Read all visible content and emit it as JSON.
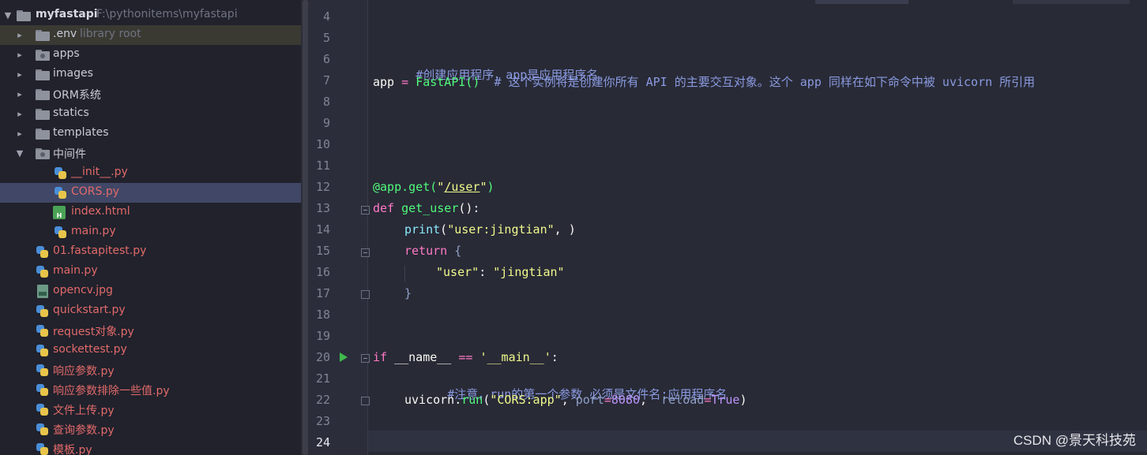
{
  "project": {
    "name": "myfastapi",
    "path": "F:\\pythonitems\\myfastapi"
  },
  "tree": [
    {
      "label": "myfastapi",
      "extra": "F:\\pythonitems\\myfastapi"
    },
    {
      "label": ".env",
      "extra": "library root"
    },
    {
      "label": "apps"
    },
    {
      "label": "images"
    },
    {
      "label": "ORM系统"
    },
    {
      "label": "statics"
    },
    {
      "label": "templates"
    },
    {
      "label": "中间件"
    },
    {
      "label": "__init__.py"
    },
    {
      "label": "CORS.py"
    },
    {
      "label": "index.html"
    },
    {
      "label": "main.py"
    },
    {
      "label": "01.fastapitest.py"
    },
    {
      "label": "main.py"
    },
    {
      "label": "opencv.jpg"
    },
    {
      "label": "quickstart.py"
    },
    {
      "label": "request对象.py"
    },
    {
      "label": "sockettest.py"
    },
    {
      "label": "响应参数.py"
    },
    {
      "label": "响应参数排除一些值.py"
    },
    {
      "label": "文件上传.py"
    },
    {
      "label": "查询参数.py"
    },
    {
      "label": "模板.py"
    }
  ],
  "gutter": {
    "line_numbers": [
      "4",
      "5",
      "6",
      "7",
      "8",
      "9",
      "10",
      "11",
      "12",
      "13",
      "14",
      "15",
      "16",
      "17",
      "18",
      "19",
      "20",
      "21",
      "22",
      "23",
      "24"
    ],
    "current_line": "24"
  },
  "code": {
    "line6": "#创建应用程序，app是应用程序名",
    "line7_var": "app",
    "line7_eq": " = ",
    "line7_call": "FastAPI()",
    "line7_comment": "  # 这个实例将是创建你所有 API 的主要交互对象。这个 app 同样在如下命令中被 uvicorn 所引用",
    "line12_dec": "@app.get(",
    "line12_q1": "\"",
    "line12_path": "/user",
    "line12_q2": "\"",
    "line12_close": ")",
    "line13_kw": "def ",
    "line13_fn": "get_user",
    "line13_rest": "():",
    "line14_fn": "print",
    "line14_open": "(",
    "line14_str": "\"user:jingtian\"",
    "line14_rest": ", )",
    "line15_kw": "return",
    "line15_brace": " {",
    "line16_key": "\"user\"",
    "line16_colon": ": ",
    "line16_val": "\"jingtian\"",
    "line17_brace": "}",
    "line20_kw": "if ",
    "line20_name": "__name__",
    "line20_eq": " == ",
    "line20_str": "'__main__'",
    "line20_colon": ":",
    "line21": "#注意，run的第一个参数 必须是文件名:应用程序名",
    "line22_obj": "uvicorn.",
    "line22_fn": "run",
    "line22_open": "(",
    "line22_str": "\"CORS:app\"",
    "line22_c1": ", ",
    "line22_p1": "port",
    "line22_eq1": "=",
    "line22_n1": "8080",
    "line22_c2": ",  ",
    "line22_p2": "reload",
    "line22_eq2": "=",
    "line22_v2": "True",
    "line22_close": ")"
  },
  "watermark": "CSDN @景天科技苑",
  "colors": {
    "background": "#282a36",
    "sidebar": "#21222c",
    "selection": "#414766",
    "error_file": "#e26a6a",
    "run_icon": "#3fb94d"
  }
}
